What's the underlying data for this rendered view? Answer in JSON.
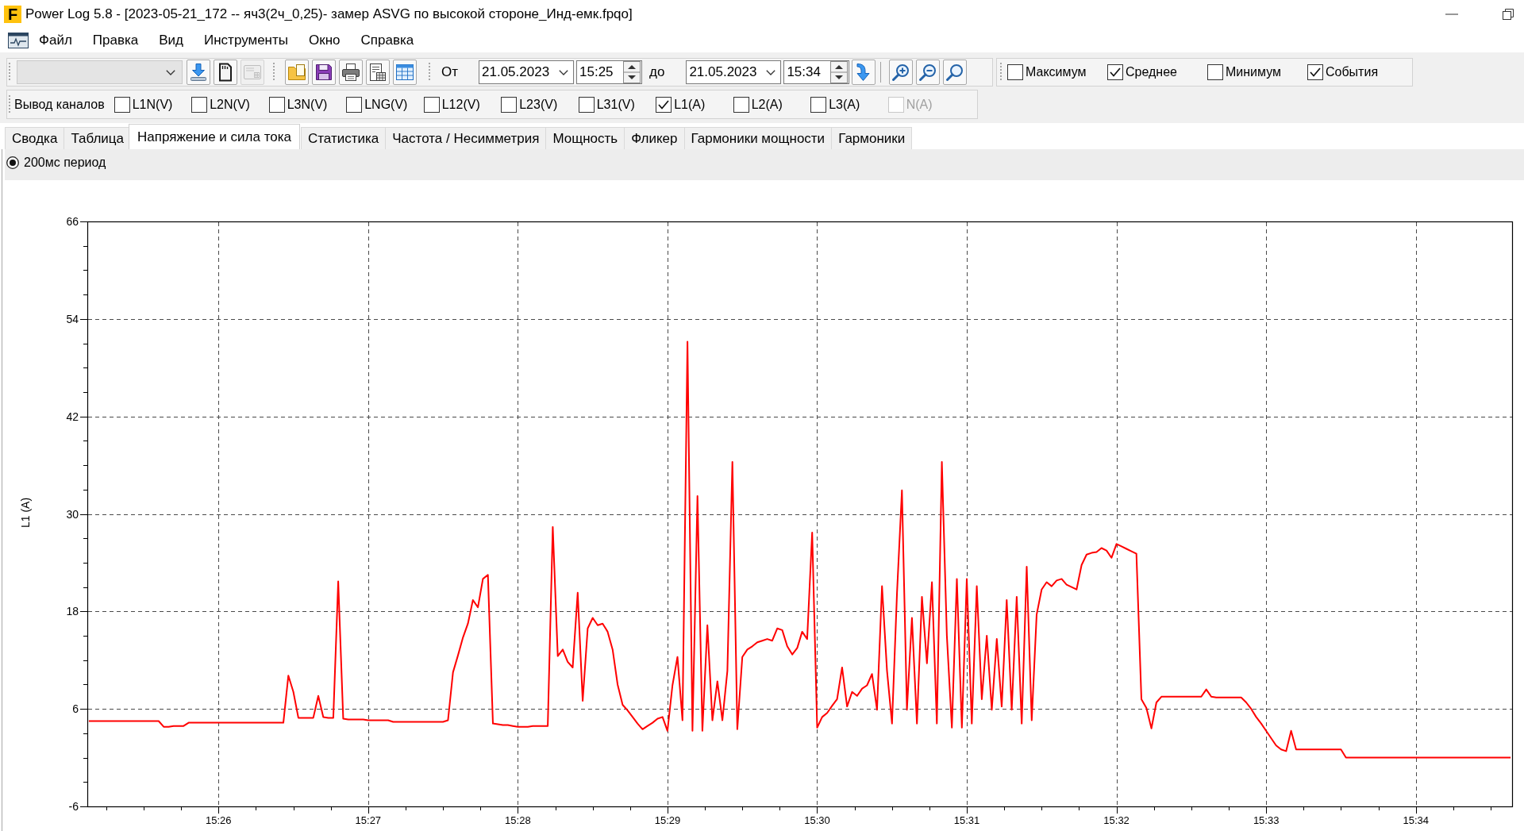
{
  "window": {
    "logo": "F",
    "title": "Power Log 5.8 - [2023-05-21_172 -- яч3(2ч_0,25)- замер ASVG по высокой стороне_Инд-емк.fpqo]"
  },
  "menu": [
    {
      "label": "Файл"
    },
    {
      "label": "Правка"
    },
    {
      "label": "Вид"
    },
    {
      "label": "Инструменты"
    },
    {
      "label": "Окно"
    },
    {
      "label": "Справка"
    }
  ],
  "toolbar": {
    "device_select": {
      "disabled": true
    },
    "device_buttons": [
      {
        "kind": "download",
        "disabled": false
      },
      {
        "kind": "memory_card",
        "disabled": false
      },
      {
        "kind": "device",
        "disabled": true
      }
    ],
    "file_buttons": [
      {
        "kind": "open"
      },
      {
        "kind": "save"
      },
      {
        "kind": "print"
      },
      {
        "kind": "report"
      },
      {
        "kind": "table"
      }
    ],
    "range": {
      "from_label": "От",
      "from_date": "21.05.2023",
      "from_time": "15:25",
      "to_label": "до",
      "to_date": "21.05.2023",
      "to_time": "15:34"
    },
    "apply_button": {
      "kind": "arrow_down"
    },
    "zoom_buttons": [
      {
        "kind": "zoom_in"
      },
      {
        "kind": "zoom_out"
      },
      {
        "kind": "zoom_fit"
      }
    ],
    "display_options": [
      {
        "label": "Максимум",
        "checked": false
      },
      {
        "label": "Среднее",
        "checked": true
      },
      {
        "label": "Минимум",
        "checked": false
      },
      {
        "label": "События",
        "checked": true
      }
    ]
  },
  "channel_bar": {
    "label": "Вывод каналов",
    "channels": [
      {
        "label": "L1N(V)",
        "checked": false,
        "disabled": false
      },
      {
        "label": "L2N(V)",
        "checked": false,
        "disabled": false
      },
      {
        "label": "L3N(V)",
        "checked": false,
        "disabled": false
      },
      {
        "label": "LNG(V)",
        "checked": false,
        "disabled": false
      },
      {
        "label": "L12(V)",
        "checked": false,
        "disabled": false
      },
      {
        "label": "L23(V)",
        "checked": false,
        "disabled": false
      },
      {
        "label": "L31(V)",
        "checked": false,
        "disabled": false
      },
      {
        "label": "L1(A)",
        "checked": true,
        "disabled": false
      },
      {
        "label": "L2(A)",
        "checked": false,
        "disabled": false
      },
      {
        "label": "L3(A)",
        "checked": false,
        "disabled": false
      },
      {
        "label": "N(A)",
        "checked": false,
        "disabled": true
      }
    ]
  },
  "tabs": [
    {
      "label": "Сводка",
      "selected": false
    },
    {
      "label": "Таблица",
      "selected": false
    },
    {
      "label": "Напряжение и сила тока",
      "selected": true
    },
    {
      "label": "Статистика",
      "selected": false
    },
    {
      "label": "Частота / Несимметрия",
      "selected": false
    },
    {
      "label": "Мощность",
      "selected": false
    },
    {
      "label": "Фликер",
      "selected": false
    },
    {
      "label": "Гармоники мощности",
      "selected": false
    },
    {
      "label": "Гармоники",
      "selected": false
    }
  ],
  "period_options": [
    {
      "label": "200мс период",
      "selected": true
    }
  ],
  "chart": {
    "chart_data": {
      "type": "line",
      "ylabel": "L1 (A)",
      "grid": true,
      "ylim": [
        -6,
        66
      ],
      "yticks": [
        -6,
        6,
        18,
        30,
        42,
        54,
        66
      ],
      "categories": [
        null,
        null,
        null,
        null,
        null,
        null,
        null,
        null,
        null,
        null,
        null,
        null,
        null,
        null,
        null,
        null,
        null,
        null,
        null,
        null,
        null,
        null,
        null,
        null,
        null,
        null,
        "15:26",
        null,
        null,
        null,
        null,
        null,
        null,
        null,
        null,
        null,
        null,
        null,
        null,
        null,
        null,
        null,
        null,
        null,
        null,
        null,
        null,
        null,
        null,
        null,
        null,
        null,
        null,
        null,
        null,
        null,
        "15:27",
        null,
        null,
        null,
        null,
        null,
        null,
        null,
        null,
        null,
        null,
        null,
        null,
        null,
        null,
        null,
        null,
        null,
        null,
        null,
        null,
        null,
        null,
        null,
        null,
        null,
        null,
        null,
        null,
        null,
        "15:28",
        null,
        null,
        null,
        null,
        null,
        null,
        null,
        null,
        null,
        null,
        null,
        null,
        null,
        null,
        null,
        null,
        null,
        null,
        null,
        null,
        null,
        null,
        null,
        null,
        null,
        null,
        null,
        null,
        null,
        "15:29",
        null,
        null,
        null,
        null,
        null,
        null,
        null,
        null,
        null,
        null,
        null,
        null,
        null,
        null,
        null,
        null,
        null,
        null,
        null,
        null,
        null,
        null,
        null,
        null,
        null,
        null,
        null,
        null,
        null,
        "15:30",
        null,
        null,
        null,
        null,
        null,
        null,
        null,
        null,
        null,
        null,
        null,
        null,
        null,
        null,
        null,
        null,
        null,
        null,
        null,
        null,
        null,
        null,
        null,
        null,
        null,
        null,
        null,
        null,
        null,
        "15:31",
        null,
        null,
        null,
        null,
        null,
        null,
        null,
        null,
        null,
        null,
        null,
        null,
        null,
        null,
        null,
        null,
        null,
        null,
        null,
        null,
        null,
        null,
        null,
        null,
        null,
        null,
        null,
        null,
        null,
        "15:32",
        null,
        null,
        null,
        null,
        null,
        null,
        null,
        null,
        null,
        null,
        null,
        null,
        null,
        null,
        null,
        null,
        null,
        null,
        null,
        null,
        null,
        null,
        null,
        null,
        null,
        null,
        null,
        null,
        null,
        "15:33",
        null,
        null,
        null,
        null,
        null,
        null,
        null,
        null,
        null,
        null,
        null,
        null,
        null,
        null,
        null,
        null,
        null,
        null,
        null,
        null,
        null,
        null,
        null,
        null,
        null,
        null,
        null,
        null,
        null,
        "15:34",
        null,
        null,
        null,
        null,
        null,
        null,
        null,
        null,
        null,
        null,
        null,
        null,
        null,
        null,
        null,
        null,
        null,
        null,
        null
      ],
      "series": [
        {
          "color": "#ff0000",
          "values": [
            4.5,
            4.5,
            4.5,
            4.5,
            4.5,
            4.5,
            4.5,
            4.5,
            4.5,
            4.5,
            4.5,
            4.5,
            4.5,
            4.5,
            4.5,
            3.8,
            3.8,
            3.9,
            3.9,
            3.9,
            4.3,
            4.3,
            4.3,
            4.3,
            4.3,
            4.3,
            4.3,
            4.3,
            4.3,
            4.3,
            4.3,
            4.3,
            4.3,
            4.3,
            4.3,
            4.3,
            4.3,
            4.3,
            4.3,
            4.3,
            10.1,
            8.1,
            4.9,
            4.9,
            4.9,
            4.9,
            7.6,
            5.0,
            4.9,
            4.9,
            21.7,
            4.8,
            4.7,
            4.7,
            4.7,
            4.7,
            4.6,
            4.6,
            4.6,
            4.6,
            4.6,
            4.4,
            4.4,
            4.4,
            4.4,
            4.4,
            4.4,
            4.4,
            4.4,
            4.4,
            4.4,
            4.4,
            4.6,
            10.5,
            12.6,
            14.8,
            16.5,
            19.4,
            18.5,
            22.0,
            22.5,
            4.2,
            4.1,
            4.0,
            4.0,
            3.9,
            3.8,
            3.8,
            3.8,
            3.9,
            3.9,
            3.9,
            3.9,
            28.4,
            12.5,
            13.3,
            11.8,
            11.1,
            20.3,
            7.0,
            15.9,
            17.2,
            16.3,
            16.5,
            15.5,
            13.3,
            9.0,
            6.5,
            5.8,
            5.0,
            4.2,
            3.5,
            3.9,
            4.3,
            4.8,
            5.0,
            3.3,
            8.9,
            12.4,
            4.6,
            51.2,
            3.3,
            32.2,
            3.3,
            16.3,
            4.6,
            9.4,
            4.6,
            10.7,
            36.4,
            3.5,
            12.4,
            13.3,
            13.7,
            14.2,
            14.4,
            14.6,
            14.4,
            15.9,
            15.7,
            13.7,
            12.7,
            13.5,
            15.5,
            14.6,
            27.7,
            3.7,
            5.0,
            5.5,
            6.4,
            7.2,
            11.1,
            6.3,
            8.1,
            7.6,
            8.5,
            8.9,
            10.3,
            5.9,
            21.1,
            10.7,
            4.2,
            20.3,
            32.9,
            5.9,
            17.2,
            4.2,
            19.8,
            11.6,
            21.6,
            4.2,
            36.4,
            15.0,
            3.7,
            22.0,
            3.7,
            22.0,
            4.2,
            21.1,
            7.2,
            15.0,
            5.9,
            14.6,
            6.3,
            19.4,
            5.9,
            19.8,
            4.2,
            23.5,
            4.6,
            17.6,
            20.7,
            21.6,
            21.1,
            21.8,
            22.0,
            21.3,
            21.0,
            20.7,
            23.7,
            25.0,
            25.2,
            25.3,
            25.8,
            25.5,
            24.6,
            26.3,
            26.0,
            25.7,
            25.4,
            25.1,
            7.2,
            6.1,
            3.6,
            6.8,
            7.5,
            7.5,
            7.5,
            7.5,
            7.5,
            7.5,
            7.5,
            7.5,
            7.5,
            8.4,
            7.5,
            7.4,
            7.4,
            7.4,
            7.4,
            7.4,
            7.4,
            6.8,
            6.0,
            5.0,
            4.2,
            3.3,
            2.4,
            1.5,
            1.0,
            0.8,
            3.3,
            1.0,
            1.0,
            1.0,
            1.0,
            1.0,
            1.0,
            1.0,
            1.0,
            1.0,
            1.0,
            0,
            0,
            0,
            0,
            0,
            0,
            0,
            0,
            0,
            0,
            0,
            0,
            0,
            0,
            0,
            0,
            0,
            0,
            0,
            0,
            0,
            0,
            0,
            0,
            0,
            0,
            0,
            0,
            0,
            0,
            0,
            0,
            0,
            0
          ]
        }
      ]
    }
  }
}
